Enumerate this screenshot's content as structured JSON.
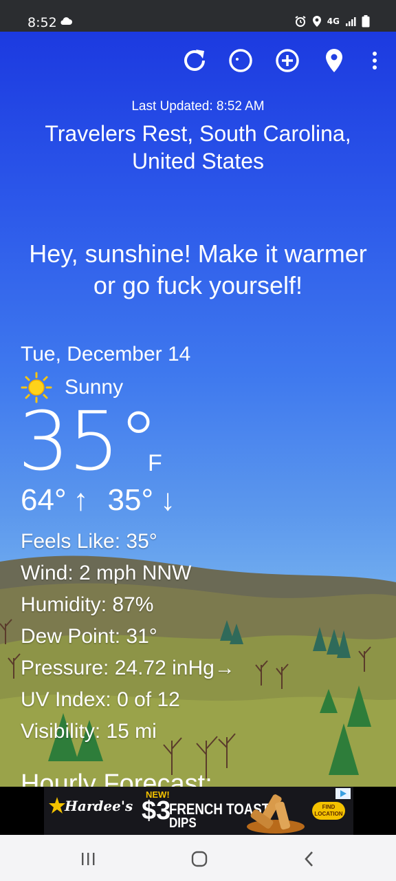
{
  "status_bar": {
    "time": "8:52",
    "network": "4G"
  },
  "toolbar": {
    "icons": [
      "refresh-icon",
      "theme-icon",
      "add-location-icon",
      "location-pin-icon",
      "more-options-icon"
    ]
  },
  "header": {
    "last_updated": "Last Updated: 8:52 AM",
    "location": "Travelers Rest, South Carolina, United States"
  },
  "quote": "Hey, sunshine! Make it warmer or go fuck yourself!",
  "current": {
    "date": "Tue, December 14",
    "condition": "Sunny",
    "temperature": "35°",
    "unit": "F",
    "high": "64°",
    "high_arrow": "↑",
    "low": "35°",
    "low_arrow": "↓"
  },
  "details": [
    {
      "text": "Feels Like:  35°"
    },
    {
      "text": "Wind:  2 mph NNW"
    },
    {
      "text": "Humidity:  87%"
    },
    {
      "text": "Dew Point:  31°"
    },
    {
      "text": "Pressure:  24.72 inHg→"
    },
    {
      "text": "UV Index:  0 of 12"
    },
    {
      "text": "Visibility:  15 mi"
    }
  ],
  "hourly_title": "Hourly Forecast:",
  "ad": {
    "brand": "Hardee's",
    "new_label": "NEW!",
    "price": "$3",
    "product_line1": "FRENCH TOAST",
    "product_line2": "DIPS",
    "find_location": "FIND LOCATION"
  },
  "colors": {
    "sky_top": "#1c3ae0",
    "sky_bottom": "#8fc6f4",
    "status_bar": "#2b2d30",
    "nav_bar": "#f4f4f6",
    "ad_accent": "#f4c200"
  }
}
